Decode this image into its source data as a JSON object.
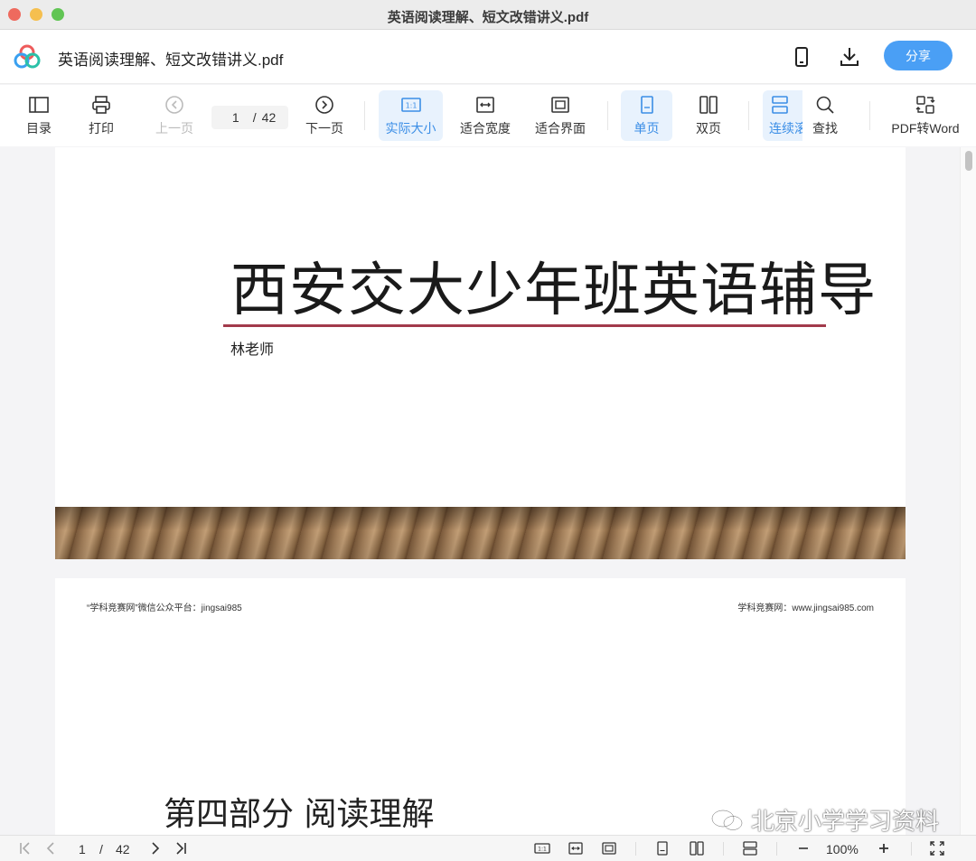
{
  "window": {
    "title": "英语阅读理解、短文改错讲义.pdf"
  },
  "header": {
    "doc_title": "英语阅读理解、短文改错讲义.pdf",
    "share_label": "分享",
    "accent": "#4a9ff5"
  },
  "toolbar": {
    "toc": "目录",
    "print": "打印",
    "prev": "上一页",
    "page_current": "1",
    "page_sep": "/",
    "page_total": "42",
    "next": "下一页",
    "actual_size": "实际大小",
    "fit_width": "适合宽度",
    "fit_window": "适合界面",
    "single_page": "单页",
    "double_page": "双页",
    "continuous": "连续滚",
    "find": "查找",
    "pdf_to_word": "PDF转Word"
  },
  "page1": {
    "title": "西安交大少年班英语辅导",
    "author": "林老师",
    "rule_color": "#a23a4b"
  },
  "page2": {
    "header_left": "“学科竞赛网”微信公众平台：jingsai985",
    "header_right": "学科竞赛网：www.jingsai985.com",
    "section_title": "第四部分  阅读理解"
  },
  "watermark": {
    "text": "北京小学学习资料"
  },
  "statusbar": {
    "page_current": "1",
    "page_sep": "/",
    "page_total": "42",
    "zoom": "100%"
  }
}
